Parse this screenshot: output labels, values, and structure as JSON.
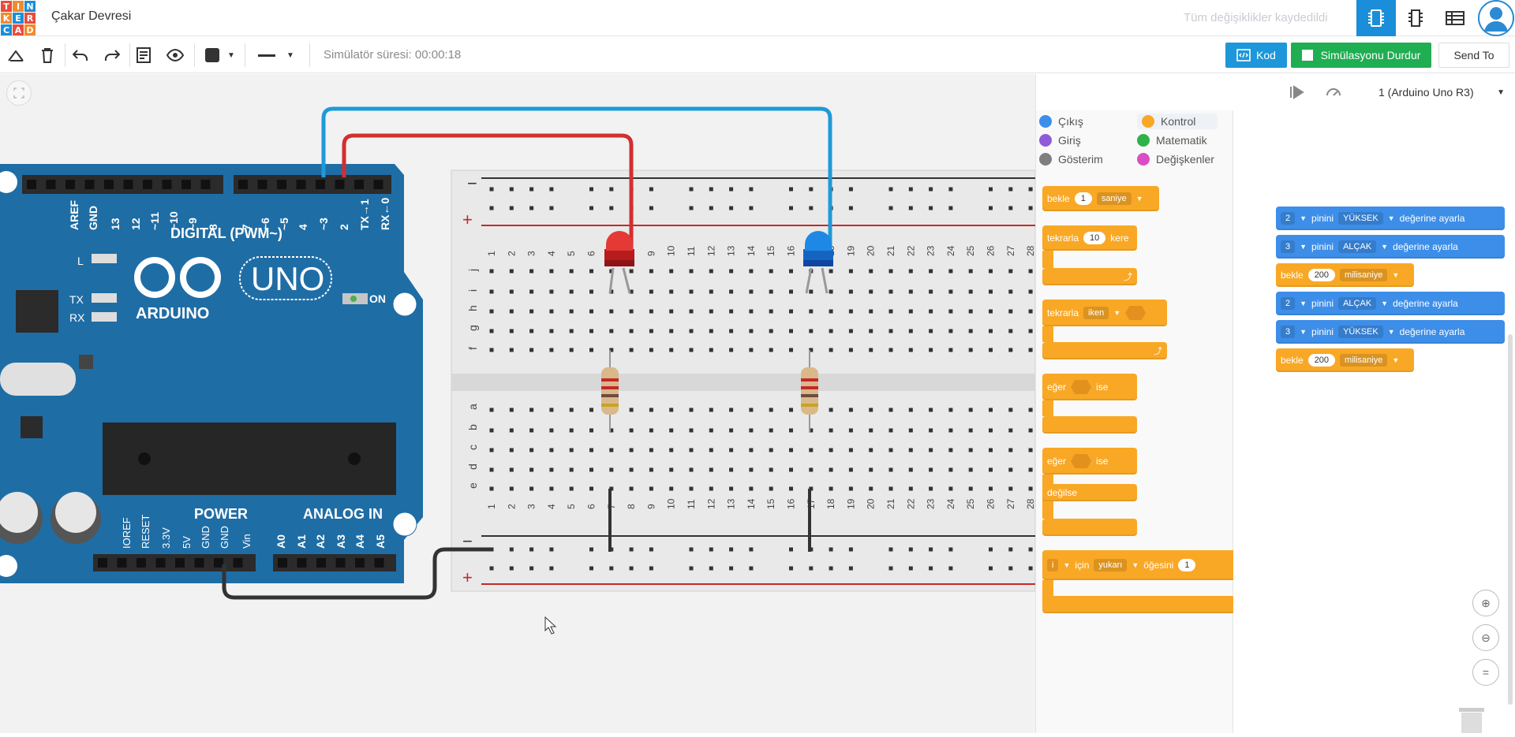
{
  "app": {
    "title": "Çakar Devresi",
    "saved_status": "Tüm değişiklikler kaydedildi",
    "logo_letters": [
      "T",
      "I",
      "N",
      "K",
      "E",
      "R",
      "C",
      "A",
      "D"
    ]
  },
  "toolbar": {
    "sim_time": "Simülatör süresi: 00:00:18",
    "code_label": "Kod",
    "sim_label": "Simülasyonu Durdur",
    "send_label": "Send To"
  },
  "code_panel": {
    "device": "1 (Arduino Uno R3)",
    "categories": [
      {
        "label": "Çıkış",
        "color": "#3d8ee8"
      },
      {
        "label": "Kontrol",
        "color": "#f9a825"
      },
      {
        "label": "Giriş",
        "color": "#8e5cd9"
      },
      {
        "label": "Matematik",
        "color": "#2fb24c"
      },
      {
        "label": "Gösterim",
        "color": "#7f7f7f"
      },
      {
        "label": "Değişkenler",
        "color": "#d94fc3"
      }
    ],
    "palette": {
      "wait": {
        "label": "bekle",
        "value": "1",
        "unit": "saniye"
      },
      "repeat": {
        "label": "tekrarla",
        "value": "10",
        "unit": "kere"
      },
      "repeat_while": {
        "label": "tekrarla",
        "cond": "iken"
      },
      "if1": {
        "label": "eğer",
        "then": "ise"
      },
      "if2": {
        "label": "eğer",
        "then": "ise",
        "else": "değilse"
      },
      "for": {
        "var": "i",
        "for": "için",
        "dir": "yukarı",
        "from": "öğesini",
        "value": "1"
      }
    },
    "script": [
      {
        "pin": "2",
        "pin_word": "pinini",
        "state": "YÜKSEK",
        "suffix": "değerine ayarla"
      },
      {
        "pin": "3",
        "pin_word": "pinini",
        "state": "ALÇAK",
        "suffix": "değerine ayarla"
      },
      {
        "wait": "bekle",
        "value": "200",
        "unit": "milisaniye"
      },
      {
        "pin": "2",
        "pin_word": "pinini",
        "state": "ALÇAK",
        "suffix": "değerine ayarla"
      },
      {
        "pin": "3",
        "pin_word": "pinini",
        "state": "YÜKSEK",
        "suffix": "değerine ayarla"
      },
      {
        "wait": "bekle",
        "value": "200",
        "unit": "milisaniye"
      }
    ]
  },
  "arduino": {
    "digital_label": "DIGITAL (PWM~)",
    "pins_top": [
      "AREF",
      "GND",
      "13",
      "12",
      "~11",
      "~10",
      "~9",
      "8",
      "7",
      "~6",
      "~5",
      "4",
      "~3",
      "2",
      "TX→1",
      "RX←0"
    ],
    "uno": "UNO",
    "brand": "ARDUINO",
    "on": "ON",
    "l": "L",
    "tx": "TX",
    "rx": "RX",
    "power": "POWER",
    "analog": "ANALOG IN",
    "pins_bottom": [
      "IOREF",
      "RESET",
      "3.3V",
      "5V",
      "GND",
      "GND",
      "Vin"
    ],
    "analog_pins": [
      "A0",
      "A1",
      "A2",
      "A3",
      "A4",
      "A5"
    ]
  },
  "breadboard": {
    "rows_top": [
      "j",
      "i",
      "h",
      "g",
      "f"
    ],
    "rows_bottom": [
      "e",
      "d",
      "c",
      "b",
      "a"
    ],
    "columns": [
      "1",
      "2",
      "3",
      "4",
      "5",
      "6",
      "7",
      "8",
      "9",
      "10",
      "11",
      "12",
      "13",
      "14",
      "15",
      "16",
      "17",
      "18",
      "19",
      "20",
      "21",
      "22",
      "23",
      "24",
      "25",
      "26",
      "27",
      "28"
    ],
    "minus": "−",
    "plus": "+"
  },
  "colors": {
    "accent": "#1b8ed9",
    "arduino_blue": "#1f6da5",
    "control_orange": "#f9a825",
    "output_blue": "#3d8ee8",
    "sim_green": "#1fae52"
  }
}
